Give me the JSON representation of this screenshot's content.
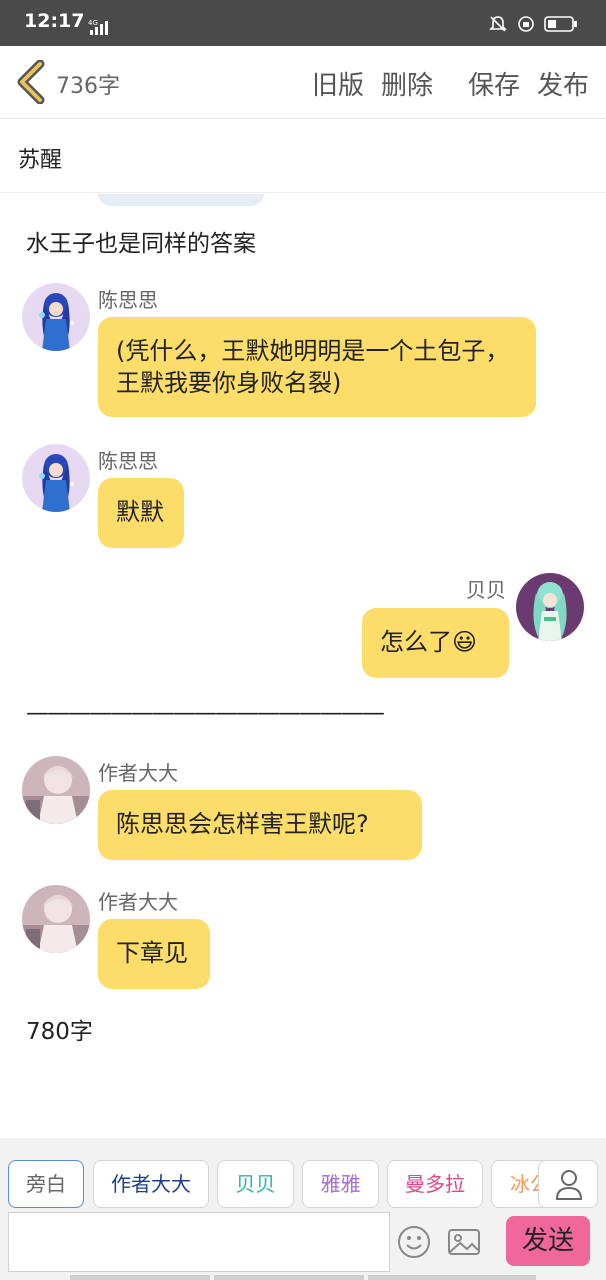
{
  "status_bar": {
    "time": "12:17",
    "network": "4G"
  },
  "header": {
    "word_count": "736字",
    "actions": {
      "old_version": "旧版",
      "delete": "删除",
      "save": "保存",
      "publish": "发布"
    }
  },
  "title": "苏醒",
  "content": {
    "narration_top": "水王子也是同样的答案",
    "messages": [
      {
        "sender": "陈思思",
        "text": "(凭什么，王默她明明是一个土包子，王默我要你身败名裂)",
        "side": "left",
        "avatar": "blue-hair-girl-avatar"
      },
      {
        "sender": "陈思思",
        "text": "默默",
        "side": "left",
        "avatar": "blue-hair-girl-avatar"
      },
      {
        "sender": "贝贝",
        "text": "怎么了😃",
        "side": "right",
        "avatar": "green-hair-girl-avatar"
      }
    ],
    "divider": "—————————————————",
    "messages2": [
      {
        "sender": "作者大大",
        "text": "陈思思会怎样害王默呢?",
        "side": "left",
        "avatar": "pink-photo-avatar"
      },
      {
        "sender": "作者大大",
        "text": "下章见",
        "side": "left",
        "avatar": "pink-photo-avatar"
      }
    ],
    "narration_bottom": "780字"
  },
  "composer": {
    "roles": [
      {
        "label": "旁白",
        "color": "#666666"
      },
      {
        "label": "作者大大",
        "color": "#1d3f8a"
      },
      {
        "label": "贝贝",
        "color": "#2bb5b0"
      },
      {
        "label": "雅雅",
        "color": "#a86ad6"
      },
      {
        "label": "曼多拉",
        "color": "#e0448a"
      },
      {
        "label": "冰公",
        "color": "#f29a5a"
      }
    ],
    "input_value": "",
    "send_label": "发送"
  }
}
